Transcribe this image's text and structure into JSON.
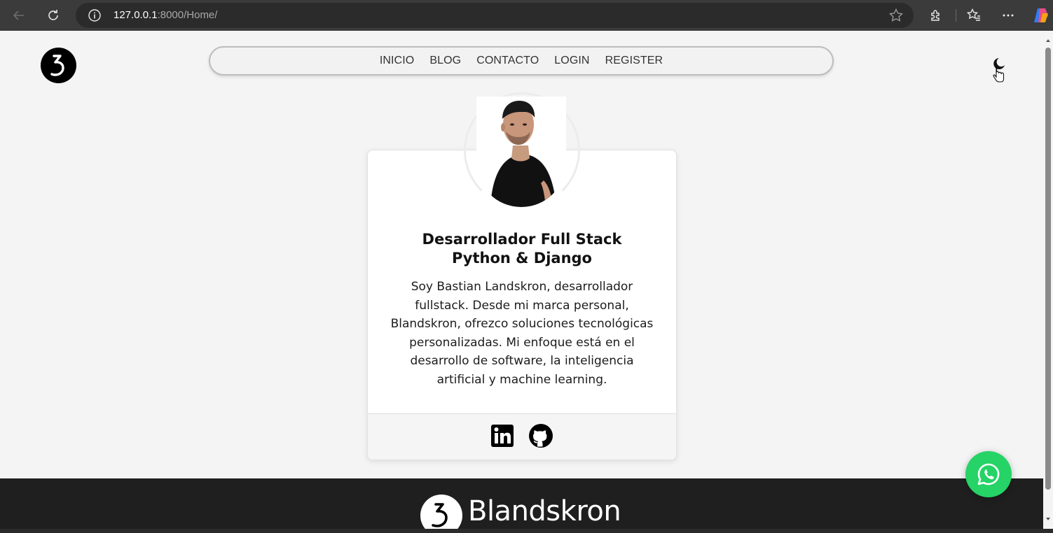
{
  "browser": {
    "url_host": "127.0.0.1",
    "url_rest": ":8000/Home/",
    "icons": [
      "back-arrow-icon",
      "reload-icon",
      "info-icon",
      "star-icon",
      "extensions-icon",
      "favorites-icon",
      "more-icon",
      "copilot-icon"
    ]
  },
  "nav": {
    "items": [
      "INICIO",
      "BLOG",
      "CONTACTO",
      "LOGIN",
      "REGISTER"
    ]
  },
  "theme_toggle": {
    "icon": "moon-icon"
  },
  "profile": {
    "title_line1": "Desarrollador Full Stack",
    "title_line2": "Python & Django",
    "bio": "Soy Bastian Landskron, desarrollador fullstack. Desde mi marca personal, Blandskron, ofrezco soluciones tecnológicas personalizadas. Mi enfoque está en el desarrollo de software, la inteligencia artificial y machine learning.",
    "social_icons": [
      "linkedin-icon",
      "github-icon"
    ]
  },
  "footer": {
    "brand_name": "Blandskron"
  },
  "colors": {
    "whatsapp": "#25d366",
    "footer_bg": "#1f1f1f",
    "page_bg": "#f4f4f4"
  }
}
